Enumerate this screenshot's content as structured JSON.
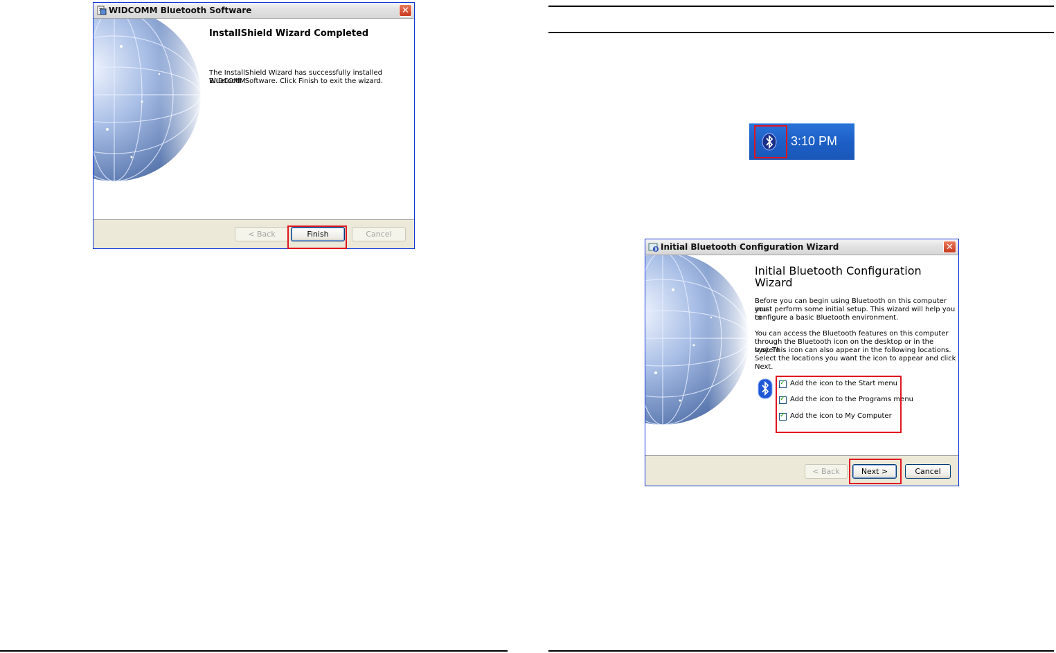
{
  "installshield": {
    "window_title": "WIDCOMM Bluetooth Software",
    "heading": "InstallShield Wizard Completed",
    "message_line1": "The InstallShield Wizard has successfully installed WIDCOMM",
    "message_line2": "Bluetooth Software. Click Finish to exit the wizard.",
    "back_label": "< Back",
    "finish_label": "Finish",
    "cancel_label": "Cancel"
  },
  "tray": {
    "time": "3:10 PM"
  },
  "bt_wizard": {
    "window_title": "Initial Bluetooth Configuration Wizard",
    "heading_line1": "Initial Bluetooth Configuration",
    "heading_line2": "Wizard",
    "para1": [
      "Before you can begin using Bluetooth on this computer you",
      "must perform some initial setup. This wizard will help you to",
      "configure a basic Bluetooth environment."
    ],
    "para2": [
      "You can access the Bluetooth features on this computer",
      "through the Bluetooth icon on the desktop or in the system",
      "tray. This icon can also appear in the following locations.",
      "Select the locations you want the icon to appear and click",
      "Next."
    ],
    "options": [
      {
        "label": "Add the icon to the Start menu",
        "checked": true
      },
      {
        "label": "Add the icon to the Programs menu",
        "checked": true
      },
      {
        "label": "Add the icon to My Computer",
        "checked": true
      }
    ],
    "back_label": "< Back",
    "next_label": "Next >",
    "cancel_label": "Cancel"
  },
  "colors": {
    "highlight": "#e0141e",
    "taskbar": "#1d5fc6"
  }
}
